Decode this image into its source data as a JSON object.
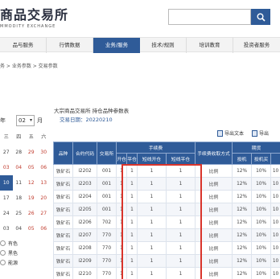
{
  "header": {
    "logo_text": "商品交易所",
    "logo_subtitle": "MMODITY EXCHANGE",
    "search_placeholder": ""
  },
  "nav": {
    "items": [
      {
        "label": "品与服务"
      },
      {
        "label": "行情数据"
      },
      {
        "label": "业务/服务"
      },
      {
        "label": "技术/规则"
      },
      {
        "label": "培训教育"
      },
      {
        "label": "投资者服务"
      }
    ]
  },
  "breadcrumb": "务 > 业务参数 > 交易参数",
  "calendar": {
    "year_suffix": "年",
    "month_value": "02",
    "month_suffix": "月",
    "weekdays": [
      "三",
      "四",
      "五",
      "六"
    ],
    "rows": [
      [
        "27",
        "28",
        "29",
        "30"
      ],
      [
        "03",
        "04",
        "05",
        "06"
      ],
      [
        "10",
        "11",
        "12",
        "13"
      ],
      [
        "17",
        "18",
        "19",
        "20"
      ],
      [
        "24",
        "25",
        "26",
        "27"
      ],
      [
        "03",
        "04",
        "05",
        "06"
      ]
    ]
  },
  "radios": [
    {
      "label": "有色"
    },
    {
      "label": "黑色"
    },
    {
      "label": "能源"
    }
  ],
  "notice": {
    "title": "大宗商品交易所 持仓品种参数表",
    "date_label": "交易日期：20220210"
  },
  "tools": {
    "export_text": "导出文本",
    "export_excel": "导出"
  },
  "table": {
    "group_header": "手续费",
    "group_header_right": "期货",
    "headers_row1": [
      "品种",
      "合约代码",
      "交易所"
    ],
    "headers_row1_right": [
      "手续费收取方式"
    ],
    "headers_row2": [
      "开仓",
      "平仓",
      "短线开仓",
      "短线平仓"
    ],
    "headers_row2_right": [
      "投机",
      "投机买"
    ],
    "rows": [
      [
        "铁矿石",
        "i2202",
        "001",
        "1",
        "1",
        "1",
        "1",
        "比例",
        "12%",
        "10%",
        "10"
      ],
      [
        "铁矿石",
        "i2203",
        "001",
        "1",
        "1",
        "1",
        "1",
        "比例",
        "12%",
        "10%",
        "10"
      ],
      [
        "铁矿石",
        "i2204",
        "001",
        "1",
        "1",
        "1",
        "1",
        "比例",
        "12%",
        "10%",
        "10"
      ],
      [
        "铁矿石",
        "i2205",
        "001",
        "1",
        "1",
        "1",
        "1",
        "比例",
        "12%",
        "10%",
        "10"
      ],
      [
        "铁矿石",
        "i2206",
        "702",
        "1",
        "1",
        "1",
        "1",
        "比例",
        "12%",
        "10%",
        "10"
      ],
      [
        "铁矿石",
        "i2207",
        "770",
        "1",
        "1",
        "1",
        "1",
        "比例",
        "12%",
        "10%",
        "10"
      ],
      [
        "铁矿石",
        "i2208",
        "770",
        "1",
        "1",
        "1",
        "1",
        "比例",
        "12%",
        "10%",
        "10"
      ],
      [
        "铁矿石",
        "i2209",
        "770",
        "1",
        "1",
        "1",
        "1",
        "比例",
        "12%",
        "10%",
        "10"
      ],
      [
        "铁矿石",
        "i2210",
        "770",
        "1",
        "1",
        "1",
        "1",
        "比例",
        "12%",
        "10%",
        "10"
      ]
    ]
  }
}
